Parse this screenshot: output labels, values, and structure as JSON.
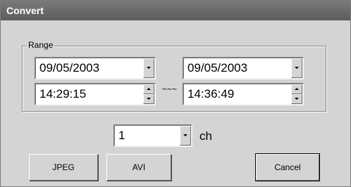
{
  "window": {
    "title": "Convert"
  },
  "range": {
    "label": "Range",
    "start_date": "09/05/2003",
    "end_date": "09/05/2003",
    "start_time": "14:29:15",
    "end_time": "14:36:49",
    "separator": "~~~"
  },
  "channel": {
    "value": "1",
    "unit_label": "ch"
  },
  "buttons": {
    "jpeg": "JPEG",
    "avi": "AVI",
    "cancel": "Cancel"
  },
  "colors": {
    "dialog_background": "#d4d4d4",
    "titlebar": "#6a6a6a",
    "field_background": "#ffffff"
  }
}
